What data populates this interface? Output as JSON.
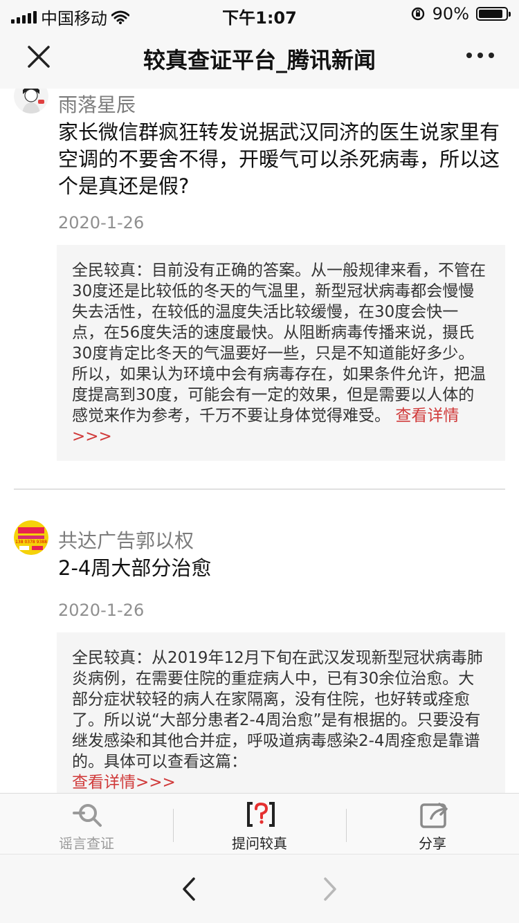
{
  "status_bar": {
    "carrier": "中国移动",
    "time": "下午1:07",
    "battery_text": "90%",
    "battery_level": 0.9
  },
  "nav": {
    "title": "较真查证平台_腾讯新闻",
    "close_icon": "close-icon",
    "more_icon": "more-icon"
  },
  "posts": [
    {
      "username": "雨落星辰",
      "question": "家长微信群疯狂转发说据武汉同济的医生说家里有空调的不要舍不得，开暖气可以杀死病毒，所以这个是真还是假?",
      "date": "2020-1-26",
      "answer": "全民较真：目前没有正确的答案。从一般规律来看，不管在30度还是比较低的冬天的气温里，新型冠状病毒都会慢慢失去活性，在较低的温度失活比较缓慢，在30度会快一点，在56度失活的速度最快。从阻断病毒传播来说，摄氏30度肯定比冬天的气温要好一些，只是不知道能好多少。所以，如果认为环境中会有病毒存在，如果条件允许，把温度提高到30度，可能会有一定的效果，但是需要以人体的感觉来作为参考，千万不要让身体觉得难受。",
      "more_link": "查看详情>>>"
    },
    {
      "username": "共达广告郭以权",
      "question": "2-4周大部分治愈",
      "date": "2020-1-26",
      "answer": "全民较真：从2019年12月下旬在武汉发现新型冠状病毒肺炎病例，在需要住院的重症病人中，已有30余位治愈。大部分症状较轻的病人在家隔离，没有住院，也好转或痊愈了。所以说“大部分患者2-4周治愈”是有根据的。只要没有继发感染和其他合并症，呼吸道病毒感染2-4周痊愈是靠谱的。具体可以查看这篇：",
      "more_link": "查看详情>>>",
      "avatar_phone": "138 0378 9388"
    }
  ],
  "toolbar": {
    "items": [
      {
        "label": "谣言查证",
        "icon": "search-icon",
        "color": "#9a9a9a"
      },
      {
        "label": "提问较真",
        "icon": "question-bracket-icon",
        "color": "#222222"
      },
      {
        "label": "分享",
        "icon": "share-icon",
        "color": "#222222"
      }
    ]
  },
  "colors": {
    "accent_red": "#d03a3a",
    "answer_bg": "#f5f5f5"
  }
}
